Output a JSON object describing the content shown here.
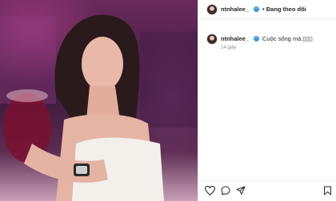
{
  "post": {
    "username": "ntnhalee_",
    "follow_status": "Đang theo dõi",
    "caption_text": "Cuộc sống mà.",
    "caption_emoji": "▯▯▯",
    "timestamp": "14 giây",
    "verified_icon": "verified-badge-icon",
    "accent_color": "#3897f0"
  },
  "actions": {
    "like_icon": "heart-icon",
    "comment_icon": "comment-icon",
    "share_icon": "share-icon",
    "save_icon": "bookmark-icon"
  }
}
